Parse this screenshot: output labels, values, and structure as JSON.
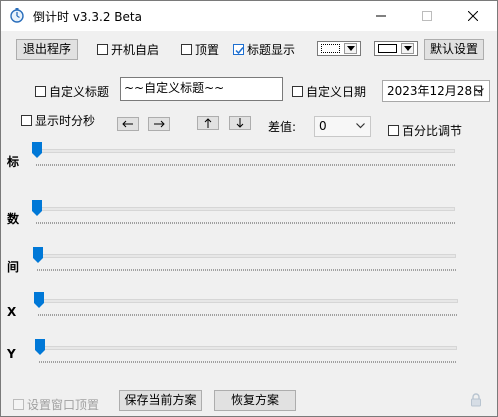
{
  "window": {
    "title": "倒计时 v3.3.2 Beta",
    "controls": {
      "minimize": "minimize-icon",
      "maximize": "maximize-icon",
      "close": "close-icon"
    }
  },
  "toolbar": {
    "exit_label": "退出程序",
    "autostart_label": "开机自启",
    "autostart_checked": false,
    "topmost_label": "顶置",
    "topmost_checked": false,
    "show_title_label": "标题显示",
    "show_title_checked": true,
    "default_settings_label": "默认设置"
  },
  "options": {
    "custom_title_label": "自定义标题",
    "custom_title_checked": false,
    "custom_title_value": "~~自定义标题~~",
    "custom_date_label": "自定义日期",
    "custom_date_checked": false,
    "date_value": "2023年12月28日",
    "show_hms_label": "显示时分秒",
    "show_hms_checked": false,
    "diff_label": "差值:",
    "diff_value": "0",
    "percent_label": "百分比调节",
    "percent_checked": false,
    "arrows": [
      "left-arrow-icon",
      "right-arrow-icon",
      "up-arrow-icon",
      "down-arrow-icon"
    ]
  },
  "sliders": [
    {
      "label": "标",
      "value": 0
    },
    {
      "label": "数",
      "value": 0
    },
    {
      "label": "间",
      "value": 0
    },
    {
      "label": "X",
      "value": 0
    },
    {
      "label": "Y",
      "value": 0
    }
  ],
  "footer": {
    "lock_window_label": "设置窗口顶置",
    "lock_window_checked": false,
    "save_label": "保存当前方案",
    "restore_label": "恢复方案",
    "lock_icon": "lock-icon"
  },
  "colors": {
    "accent": "#0078d7",
    "window_bg": "#f0f0f0",
    "button_bg": "#e1e1e1"
  }
}
